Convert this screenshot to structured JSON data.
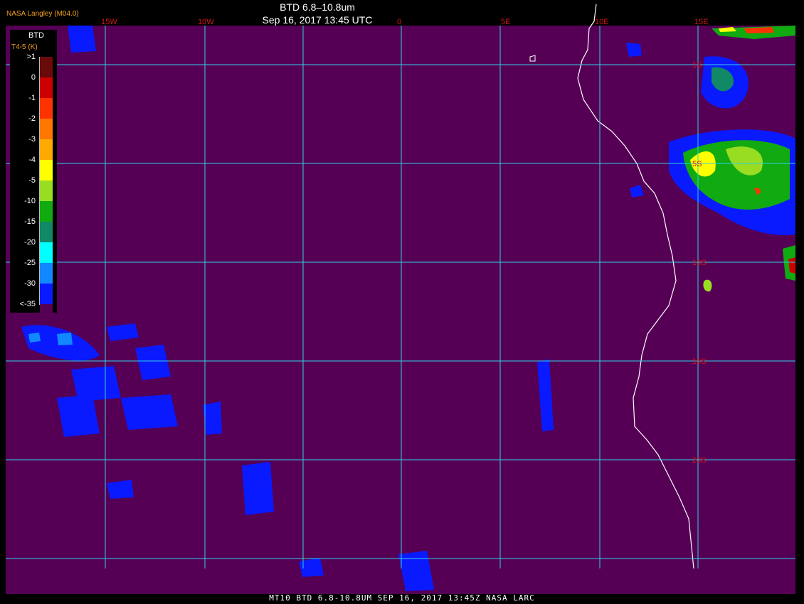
{
  "title": "BTD 6.8–10.8um",
  "subtitle": "Sep 16, 2017 13:45 UTC",
  "provider": "NASA Langley (M04.0)",
  "footer": "MT10  BTD 6.8-10.8UM   SEP 16, 2017 13:45Z   NASA LARC",
  "colors": {
    "background": "#550055",
    "grid": "#30d0e8",
    "lon_label": "#d01818",
    "coast": "#ffffff"
  },
  "lon_labels": [
    "15W",
    "10W",
    "0",
    "5E",
    "10E",
    "15E"
  ],
  "lat_labels": [
    "1S",
    "5S",
    "10S",
    "15S",
    "20S"
  ],
  "legend": {
    "title": "BTD",
    "subtitle": "T4-5 (K)",
    "labels": [
      ">1",
      "0",
      "-1",
      "-2",
      "-3",
      "-4",
      "-5",
      "-10",
      "-15",
      "-20",
      "-25",
      "-30",
      "<-35"
    ],
    "colors": [
      "#6a0a0a",
      "#cc0000",
      "#ff3300",
      "#ff7700",
      "#ffaa00",
      "#ffff00",
      "#99dd22",
      "#11aa11",
      "#118866",
      "#00ffff",
      "#1188ff",
      "#0a1aff",
      "#550055"
    ]
  }
}
